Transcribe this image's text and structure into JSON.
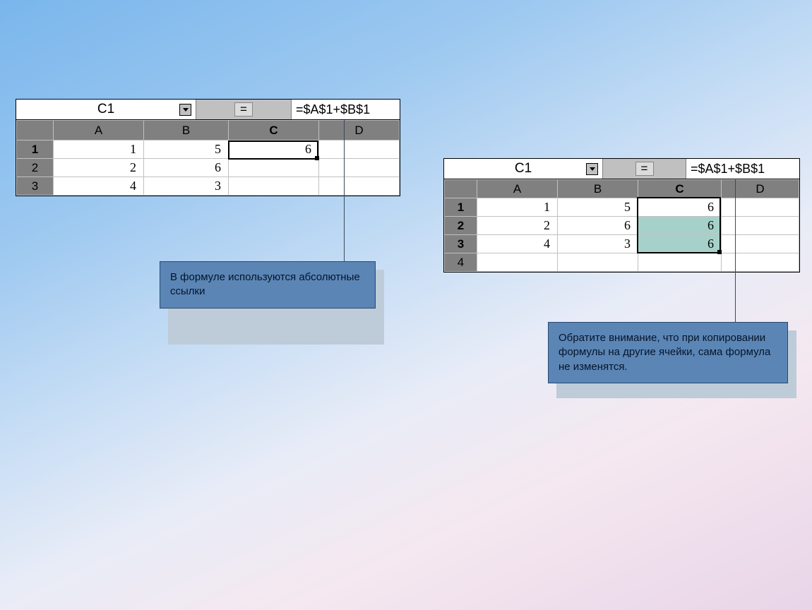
{
  "sheet1": {
    "name_box": "C1",
    "eq": "=",
    "formula": "=$A$1+$B$1",
    "cols": [
      "A",
      "B",
      "C",
      "D"
    ],
    "rows": [
      "1",
      "2",
      "3"
    ],
    "active_col": "C",
    "active_row": "1",
    "cells": {
      "A1": "1",
      "B1": "5",
      "C1": "6",
      "D1": "",
      "A2": "2",
      "B2": "6",
      "C2": "",
      "D2": "",
      "A3": "4",
      "B3": "3",
      "C3": "",
      "D3": ""
    }
  },
  "sheet2": {
    "name_box": "C1",
    "eq": "=",
    "formula": "=$A$1+$B$1",
    "cols": [
      "A",
      "B",
      "C",
      "D"
    ],
    "rows": [
      "1",
      "2",
      "3",
      "4"
    ],
    "active_col": "C",
    "active_rows": [
      "1",
      "2",
      "3"
    ],
    "cells": {
      "A1": "1",
      "B1": "5",
      "C1": "6",
      "D1": "",
      "A2": "2",
      "B2": "6",
      "C2": "6",
      "D2": "",
      "A3": "4",
      "B3": "3",
      "C3": "6",
      "D3": "",
      "A4": "",
      "B4": "",
      "C4": "",
      "D4": ""
    }
  },
  "callout1": "В формуле используются абсолютные ссылки",
  "callout2": "Обратите внимание, что при копировании формулы на другие ячейки, сама формула не изменятся."
}
